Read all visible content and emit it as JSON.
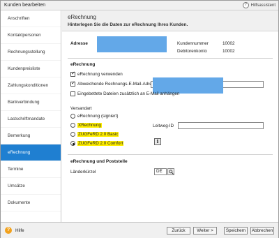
{
  "window": {
    "title": "Kunden bearbeiten",
    "assistant_label": "Hilfsassistent"
  },
  "sidebar": {
    "items": [
      {
        "label": "Anschriften"
      },
      {
        "label": "Kontaktpersonen"
      },
      {
        "label": "Rechnungsstellung"
      },
      {
        "label": "Kundenpreisliste"
      },
      {
        "label": "Zahlungskonditionen"
      },
      {
        "label": "Bankverbindung"
      },
      {
        "label": "Lastschriftmandate"
      },
      {
        "label": "Bemerkung"
      },
      {
        "label": "eRechnung",
        "active": true
      },
      {
        "label": "Termine"
      },
      {
        "label": "Umsätze"
      },
      {
        "label": "Dokumente"
      }
    ]
  },
  "header": {
    "title": "eRechnung",
    "subtitle": "Hinterlegen Sie die Daten zur eRechnung Ihres Kunden."
  },
  "address": {
    "label": "Adresse",
    "customer_number_label": "Kundennummer",
    "customer_number": "10002",
    "debtor_account_label": "Debitorenkonto",
    "debtor_account": "10002"
  },
  "erechnung": {
    "section_title": "eRechnung",
    "use_label": "eRechnung verwenden",
    "use_checked": true,
    "alt_email_label": "Abweichende Rechnungs-E-Mail-Adresse",
    "alt_email_checked": true,
    "alt_email_value": "",
    "attach_label": "Eingebettete Dateien zusätzlich an E-Mail anhängen",
    "attach_checked": false
  },
  "versandart": {
    "label": "Versandart",
    "options": [
      {
        "label": "eRechnung (signiert)",
        "selected": false,
        "highlighted": false
      },
      {
        "label": "XRechnung",
        "selected": false,
        "highlighted": true
      },
      {
        "label": "ZUGFeRD 2.0 Basic",
        "selected": false,
        "highlighted": true
      },
      {
        "label": "ZUGFeRD 2.0 Comfort",
        "selected": true,
        "highlighted": true
      }
    ],
    "leitweg_label": "Leitweg-ID",
    "leitweg_value": ""
  },
  "poststelle": {
    "section_title": "eRechnung und Poststelle",
    "country_label": "Länderkürzel",
    "country_value": "DE"
  },
  "footer": {
    "help_label": "Hilfe",
    "back_label": "Zurück",
    "next_label": "Weiter >",
    "save_label": "Speichern",
    "cancel_label": "Abbrechen"
  },
  "colors": {
    "accent": "#1f7fd1",
    "highlight": "#ffee00",
    "redaction": "#63a8e8",
    "help": "#f2a11c"
  }
}
